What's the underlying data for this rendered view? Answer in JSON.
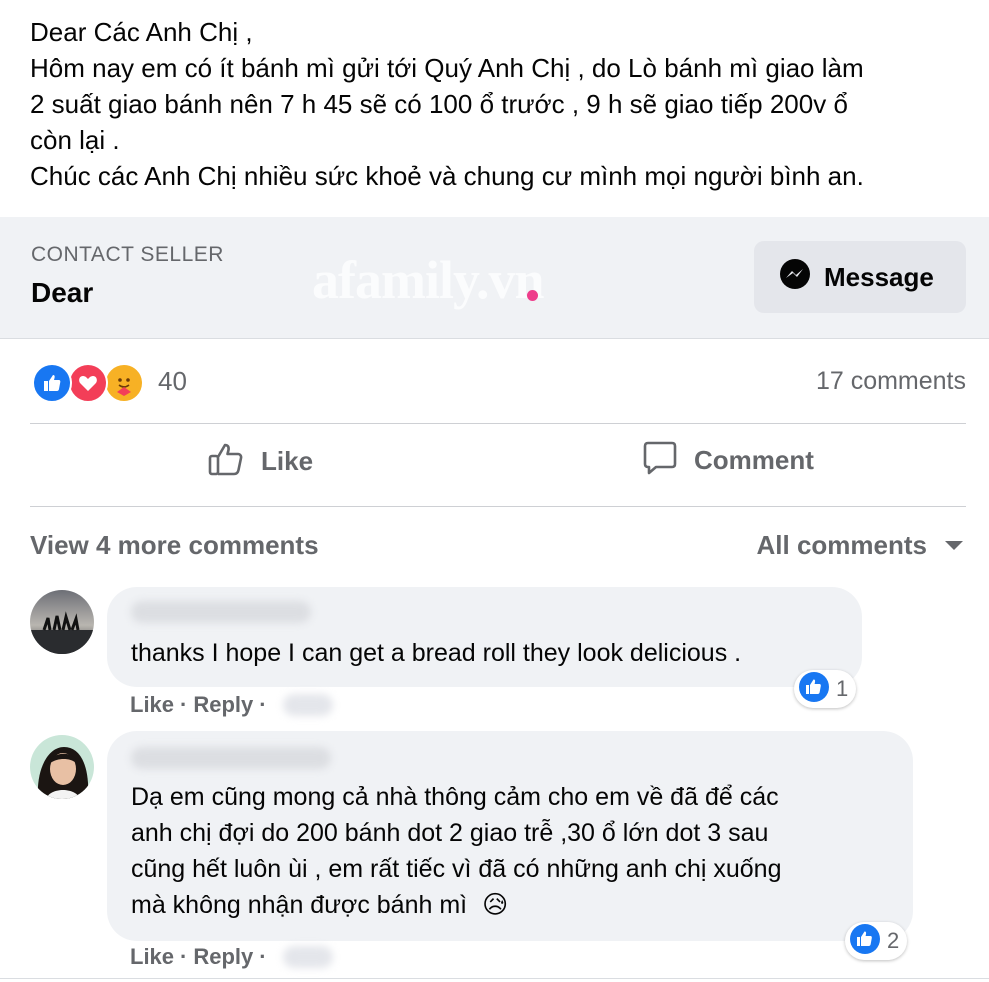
{
  "post": {
    "lines": [
      "Dear Các Anh Chị ,",
      "Hôm nay em có ít bánh mì  gửi tới Quý Anh Chị  , do Lò bánh mì giao làm",
      "2 suất giao bánh nên 7 h 45 sẽ có 100 ổ trước , 9 h sẽ giao tiếp 200v ổ",
      "còn lại .",
      "Chúc các Anh Chị nhiều sức khoẻ và chung cư mình mọi người  bình an."
    ]
  },
  "seller": {
    "label": "CONTACT SELLER",
    "name": "Dear",
    "message_label": "Message",
    "watermark": "afamily.vn"
  },
  "reactions": {
    "count": "40",
    "comments": "17 comments",
    "icons": [
      "like-icon",
      "love-icon",
      "care-icon"
    ],
    "colors": {
      "like": "#1877f2",
      "love": "#f33e58",
      "care": "#f7b125"
    }
  },
  "actions": {
    "like": "Like",
    "comment": "Comment"
  },
  "comments_header": {
    "view_more": "View 4 more comments",
    "filter": "All comments"
  },
  "comments": [
    {
      "lines": [
        "thanks I hope I can get a bread roll they look delicious ."
      ],
      "like": "Like",
      "reply": "Reply",
      "reaction_count": "1"
    },
    {
      "lines": [
        "Dạ em cũng mong cả nhà thông cảm cho em về đã để các",
        "anh chị đợi do 200 bánh dot 2 giao trễ ,30 ổ lớn dot 3 sau",
        "cũng hết luôn ùi , em rất tiếc vì đã có những anh chị xuống",
        "mà không nhận được bánh mì"
      ],
      "emoji": "😥",
      "like": "Like",
      "reply": "Reply",
      "reaction_count": "2"
    }
  ]
}
